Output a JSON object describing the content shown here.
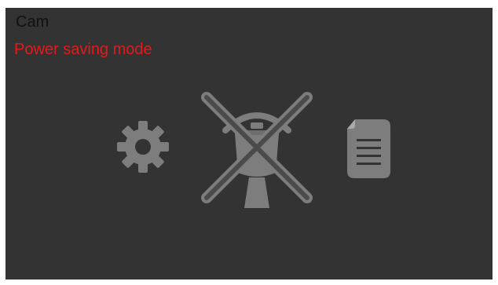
{
  "header": {
    "title": "Cam",
    "status": "Power saving mode"
  },
  "icons": {
    "settings": "gear-icon",
    "camera": "camera-disabled-icon",
    "document": "document-icon"
  },
  "colors": {
    "background": "#333333",
    "icon": "#7d7d7d",
    "status": "#e51a1a"
  }
}
